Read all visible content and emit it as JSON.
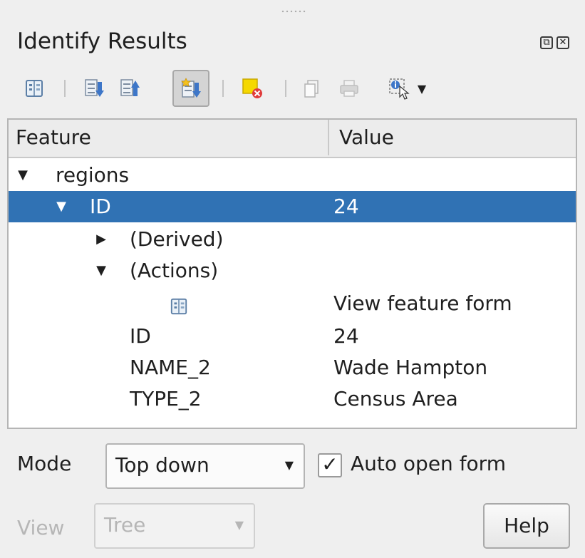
{
  "panel": {
    "title": "Identify Results",
    "float_glyph": "⧉",
    "close_glyph": "✕"
  },
  "toolbar": {
    "buttons": [
      {
        "name": "form-view-icon",
        "state": "normal"
      },
      {
        "name": "expand-all-icon",
        "state": "normal"
      },
      {
        "name": "collapse-all-icon",
        "state": "normal"
      },
      {
        "name": "expand-new-results-icon",
        "state": "active"
      },
      {
        "name": "clear-highlights-icon",
        "state": "normal"
      },
      {
        "name": "copy-icon",
        "state": "disabled"
      },
      {
        "name": "print-icon",
        "state": "disabled"
      },
      {
        "name": "identify-settings-icon",
        "state": "normal"
      }
    ]
  },
  "tree": {
    "columns": [
      "Feature",
      "Value"
    ],
    "rows": [
      {
        "arrow": "▼",
        "label": "regions",
        "value": ""
      },
      {
        "arrow": "▼",
        "label": "ID",
        "value": "24"
      },
      {
        "arrow": "▶",
        "label": "(Derived)",
        "value": ""
      },
      {
        "arrow": "▼",
        "label": "(Actions)",
        "value": ""
      },
      {
        "arrow": "",
        "label": "",
        "value": "View feature form"
      },
      {
        "arrow": "",
        "label": "ID",
        "value": "24"
      },
      {
        "arrow": "",
        "label": "NAME_2",
        "value": "Wade Hampton"
      },
      {
        "arrow": "",
        "label": "TYPE_2",
        "value": "Census Area"
      }
    ]
  },
  "bottom": {
    "mode_label": "Mode",
    "mode_value": "Top down",
    "auto_open_label": "Auto open form",
    "auto_open_checked": "✓",
    "view_label": "View",
    "view_value": "Tree",
    "help_label": "Help"
  },
  "colors": {
    "selection": "#3072b4",
    "panel_bg": "#efefef"
  }
}
